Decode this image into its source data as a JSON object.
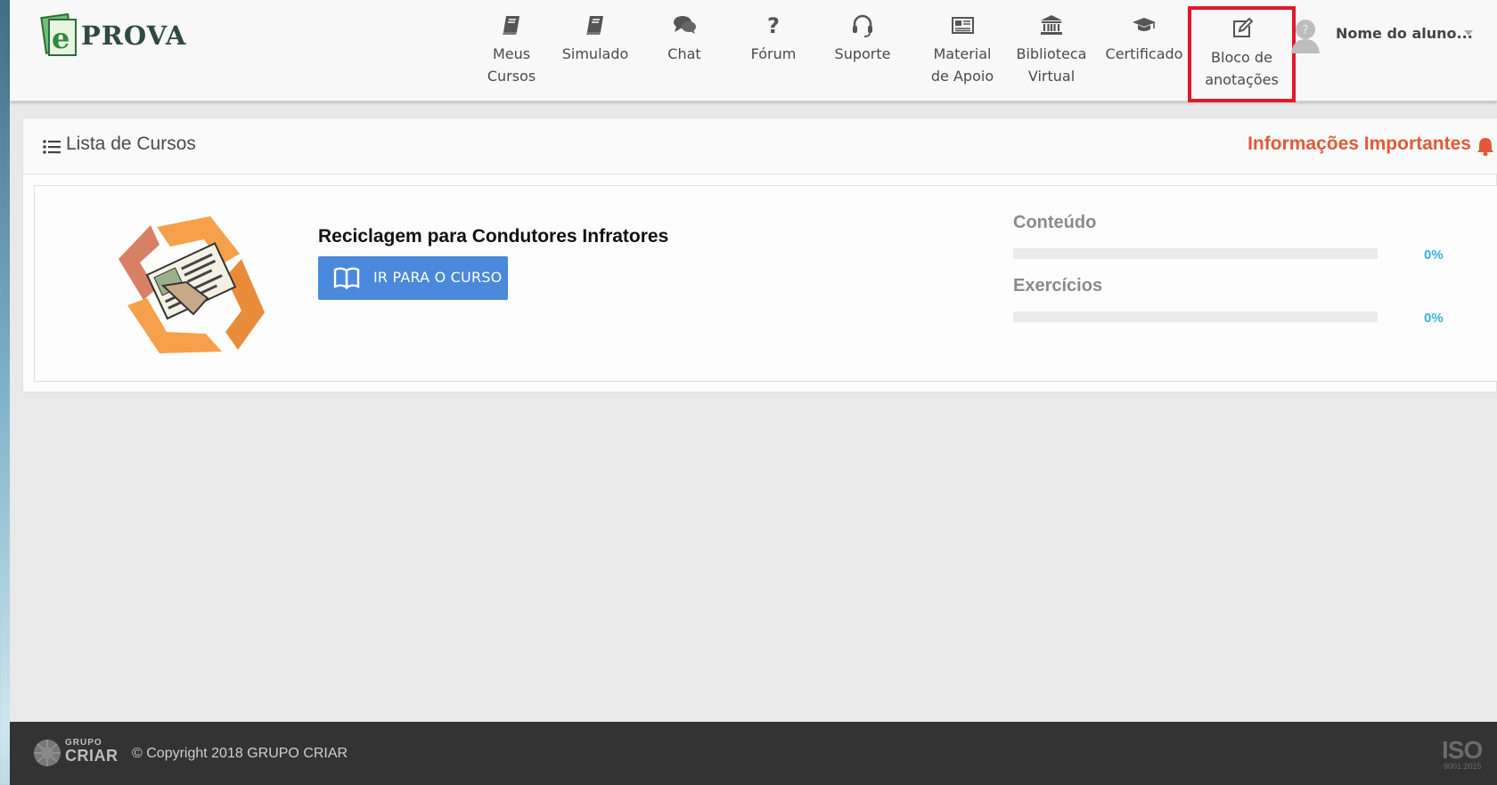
{
  "header": {
    "logo_text": "PROVA",
    "nav": [
      {
        "label": "Meus\nCursos",
        "icon": "book-icon"
      },
      {
        "label": "Simulado",
        "icon": "book-icon"
      },
      {
        "label": "Chat",
        "icon": "chat-icon"
      },
      {
        "label": "Fórum",
        "icon": "question-icon"
      },
      {
        "label": "Suporte",
        "icon": "headset-icon"
      },
      {
        "label": "Material\nde Apoio",
        "icon": "newspaper-icon"
      },
      {
        "label": "Biblioteca\nVirtual",
        "icon": "bank-icon"
      },
      {
        "label": "Certificado",
        "icon": "graduation-cap-icon"
      },
      {
        "label": "Bloco de\nanotações",
        "icon": "edit-icon",
        "highlighted": true
      }
    ],
    "user_name": "Nome do aluno..."
  },
  "panel": {
    "title": "Lista de Cursos",
    "info_link": "Informações Importantes"
  },
  "course": {
    "name": "Reciclagem para Condutores Infratores",
    "button_label": "IR PARA O CURSO",
    "progress": [
      {
        "label": "Conteúdo",
        "value_text": "0%",
        "value": 0
      },
      {
        "label": "Exercícios",
        "value_text": "0%",
        "value": 0
      }
    ]
  },
  "footer": {
    "logo_top": "GRUPO",
    "logo_bottom": "CRIAR",
    "copyright": "© Copyright 2018 GRUPO CRIAR",
    "iso_main": "ISO",
    "iso_sub": "9001:2015"
  },
  "colors": {
    "accent_blue": "#4a89dc",
    "info_orange": "#e05a3a",
    "progress_blue": "#3aaee0",
    "highlight_red": "#e0192b"
  }
}
